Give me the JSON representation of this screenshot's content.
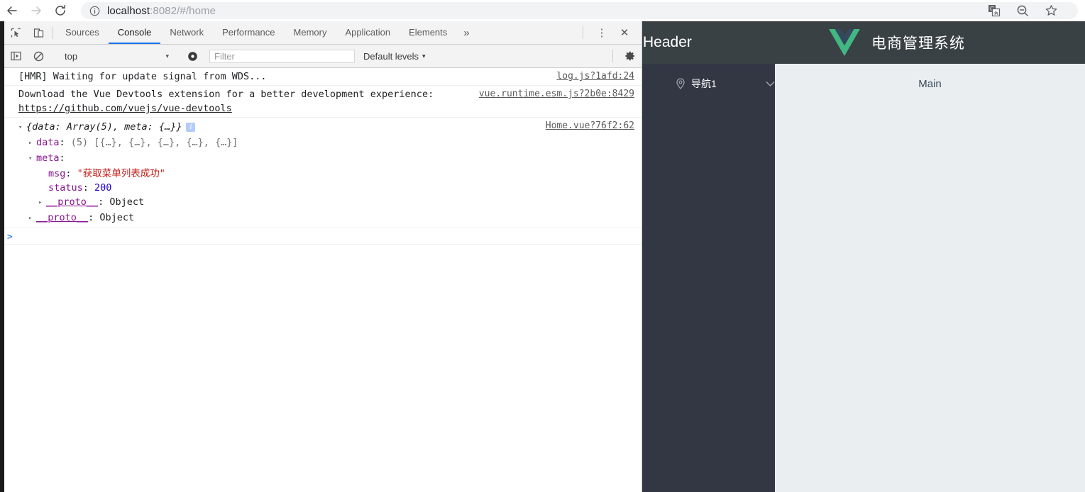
{
  "browser": {
    "back_label": "back-arrow",
    "forward_label": "forward-arrow",
    "reload_label": "reload",
    "url_host": "localhost",
    "url_rest": ":8082/#/home",
    "actions": [
      "translate-icon",
      "zoom-out-icon",
      "bookmark-star-icon"
    ]
  },
  "devtools": {
    "toolbar_icons": [
      "inspect-element-icon",
      "device-toolbar-icon"
    ],
    "tabs": [
      {
        "label": "Sources",
        "active": false
      },
      {
        "label": "Console",
        "active": true
      },
      {
        "label": "Network",
        "active": false
      },
      {
        "label": "Performance",
        "active": false
      },
      {
        "label": "Memory",
        "active": false
      },
      {
        "label": "Application",
        "active": false
      },
      {
        "label": "Elements",
        "active": false
      }
    ],
    "more_tabs": "»",
    "menu_icon": "⋮",
    "close_icon": "✕",
    "filterbar": {
      "context": "top",
      "caret": "▾",
      "filter_placeholder": "Filter",
      "filter_value": "",
      "levels_label": "Default levels",
      "settings_icon": "gear-icon",
      "eye_icon": "live-expression-icon"
    },
    "console": {
      "messages": [
        {
          "text": "[HMR] Waiting for update signal from WDS...",
          "source": "log.js?1afd:24"
        },
        {
          "text": "Download the Vue Devtools extension for a better development experience:",
          "link": "https://github.com/vuejs/vue-devtools",
          "source": "vue.runtime.esm.js?2b0e:8429"
        }
      ],
      "object_log": {
        "summary": "{data: Array(5), meta: {…}}",
        "info_badge": "i",
        "source": "Home.vue?76f2:62",
        "rows": [
          {
            "arrow": "right",
            "indent": 1,
            "key": "data",
            "sep": ": ",
            "value": "(5) [{…}, {…}, {…}, {…}, {…}]",
            "value_class": "grey"
          },
          {
            "arrow": "down",
            "indent": 1,
            "key": "meta",
            "sep": ":",
            "value": "",
            "value_class": "grey"
          },
          {
            "arrow": "none",
            "indent": 3,
            "key": "msg",
            "sep": ": ",
            "value": "\"获取菜单列表成功\"",
            "value_class": "str"
          },
          {
            "arrow": "none",
            "indent": 3,
            "key": "status",
            "sep": ": ",
            "value": "200",
            "value_class": "num"
          },
          {
            "arrow": "right",
            "indent": 2,
            "key": "__proto__",
            "sep": ": ",
            "value": "Object",
            "value_class": "plain",
            "proto": true
          },
          {
            "arrow": "right",
            "indent": 1,
            "key": "__proto__",
            "sep": ": ",
            "value": "Object",
            "value_class": "plain",
            "proto": true
          }
        ]
      },
      "prompt": ">"
    }
  },
  "app": {
    "header_label": "Header",
    "brand_title": "电商管理系统",
    "logo": "vue-logo",
    "sidebar": {
      "items": [
        {
          "label": "导航1",
          "icon": "location-pin-icon",
          "chevron": "chevron-down-icon"
        }
      ]
    },
    "main_label": "Main"
  },
  "colors": {
    "header_bg": "#3a4144",
    "sidebar_bg": "#333744",
    "main_bg": "#eaeef1",
    "vue_green": "#41b883",
    "vue_navy": "#35495e",
    "devtools_active_tab": "#1a73e8"
  }
}
